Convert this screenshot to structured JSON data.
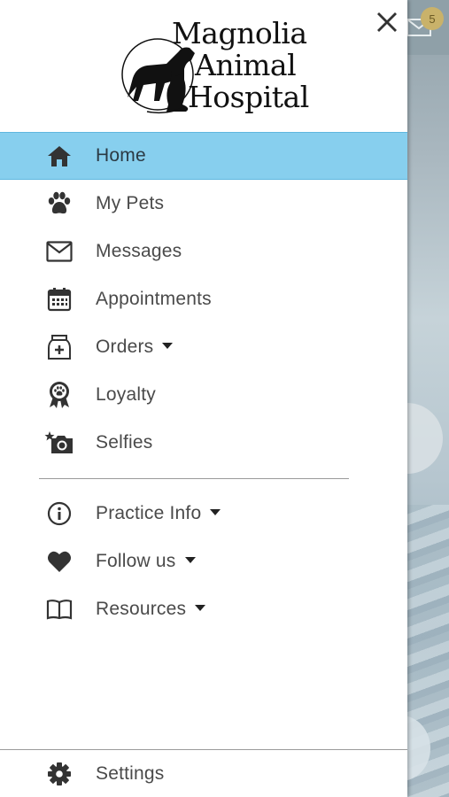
{
  "logo": {
    "line1": "Magnolia",
    "line2": "Animal",
    "line3": "Hospital"
  },
  "background": {
    "badge_count": "5"
  },
  "menu": [
    {
      "label": "Home",
      "icon": "home-icon",
      "active": true
    },
    {
      "label": "My Pets",
      "icon": "paw-icon"
    },
    {
      "label": "Messages",
      "icon": "envelope-icon"
    },
    {
      "label": "Appointments",
      "icon": "calendar-icon"
    },
    {
      "label": "Orders",
      "icon": "medication-icon",
      "dropdown": true
    },
    {
      "label": "Loyalty",
      "icon": "ribbon-paw-icon"
    },
    {
      "label": "Selfies",
      "icon": "camera-icon"
    }
  ],
  "menu2": [
    {
      "label": "Practice Info",
      "icon": "info-icon",
      "dropdown": true
    },
    {
      "label": "Follow us",
      "icon": "heart-icon",
      "dropdown": true
    },
    {
      "label": "Resources",
      "icon": "book-icon",
      "dropdown": true
    }
  ],
  "settings": {
    "label": "Settings",
    "icon": "gear-icon"
  },
  "colors": {
    "active_bg": "#87cfee",
    "text": "#4a4a4a",
    "icon": "#333333"
  }
}
